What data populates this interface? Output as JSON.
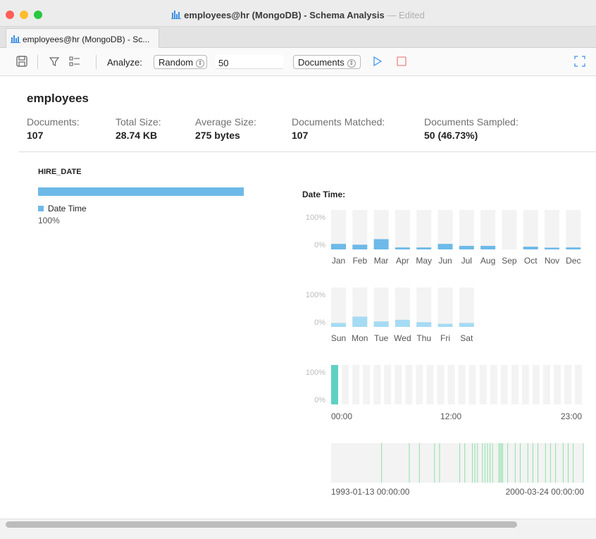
{
  "window": {
    "title": "employees@hr (MongoDB) - Schema Analysis",
    "title_sep": " — ",
    "title_status": "Edited"
  },
  "tab": {
    "label": "employees@hr (MongoDB) - Sc..."
  },
  "toolbar": {
    "analyze_label": "Analyze:",
    "mode_select": "Random",
    "sample_size": "50",
    "docs_select": "Documents",
    "icons": [
      "save-icon",
      "filter-icon",
      "fields-icon",
      "play-icon",
      "stop-icon",
      "fullscreen-icon"
    ],
    "play_color": "#3b8fe6",
    "stop_color": "#ec6b6b"
  },
  "collection": {
    "name": "employees",
    "stats": [
      {
        "label": "Documents:",
        "value": "107"
      },
      {
        "label": "Total Size:",
        "value": "28.74 KB"
      },
      {
        "label": "Average Size:",
        "value": "275 bytes"
      },
      {
        "label": "Documents Matched:",
        "value": "107"
      },
      {
        "label": "Documents Sampled:",
        "value": "50 (46.73%)"
      }
    ]
  },
  "field": {
    "name": "HIRE_DATE",
    "type_label": "Date Time",
    "type_pct": "100%",
    "type_fraction": 1.0,
    "type_color": "#6db9e8"
  },
  "chart_data": [
    {
      "type": "bar",
      "title": "Date Time:",
      "ytick_labels": [
        "100%",
        "0%"
      ],
      "categories": [
        "Jan",
        "Feb",
        "Mar",
        "Apr",
        "May",
        "Jun",
        "Jul",
        "Aug",
        "Sep",
        "Oct",
        "Nov",
        "Dec"
      ],
      "values": [
        0.14,
        0.12,
        0.26,
        0.05,
        0.05,
        0.14,
        0.09,
        0.09,
        0.0,
        0.07,
        0.03,
        0.05
      ],
      "color": "#6db9e8"
    },
    {
      "type": "bar",
      "ytick_labels": [
        "100%",
        "0%"
      ],
      "categories": [
        "Sun",
        "Mon",
        "Tue",
        "Wed",
        "Thu",
        "Fri",
        "Sat"
      ],
      "values": [
        0.1,
        0.26,
        0.14,
        0.18,
        0.12,
        0.08,
        0.1
      ],
      "color": "#a5dbf3"
    },
    {
      "type": "bar",
      "ytick_labels": [
        "100%",
        "0%"
      ],
      "x_labels": [
        "00:00",
        "12:00",
        "23:00"
      ],
      "categories": [
        "00",
        "01",
        "02",
        "03",
        "04",
        "05",
        "06",
        "07",
        "08",
        "09",
        "10",
        "11",
        "12",
        "13",
        "14",
        "15",
        "16",
        "17",
        "18",
        "19",
        "20",
        "21",
        "22",
        "23"
      ],
      "values": [
        1.0,
        0,
        0,
        0,
        0,
        0,
        0,
        0,
        0,
        0,
        0,
        0,
        0,
        0,
        0,
        0,
        0,
        0,
        0,
        0,
        0,
        0,
        0,
        0
      ],
      "color": "#5fd1c2"
    },
    {
      "type": "scatter",
      "x_range_labels": [
        "1993-01-13 00:00:00",
        "2000-03-24 00:00:00"
      ],
      "positions": [
        0.2,
        0.31,
        0.35,
        0.41,
        0.43,
        0.51,
        0.53,
        0.56,
        0.57,
        0.58,
        0.6,
        0.61,
        0.62,
        0.63,
        0.64,
        0.665,
        0.67,
        0.675,
        0.68,
        0.7,
        0.73,
        0.75,
        0.78,
        0.8,
        0.82,
        0.85,
        0.87,
        0.89,
        0.92,
        0.94,
        0.96,
        1.0
      ],
      "color": "#8fe0a8"
    }
  ]
}
